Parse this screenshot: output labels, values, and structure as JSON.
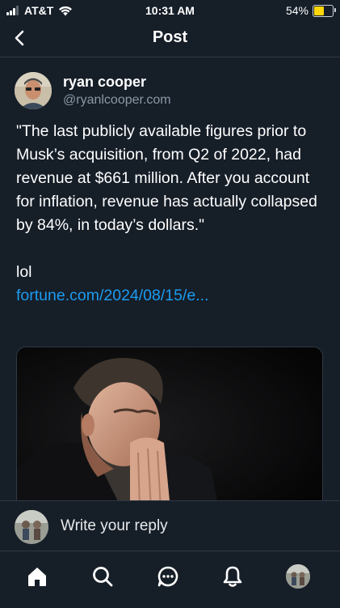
{
  "status_bar": {
    "carrier": "AT&T",
    "time": "10:31 AM",
    "battery_percent": "54%",
    "battery_level": 0.54,
    "battery_color": "#ffd60a",
    "icons": [
      "cellular-signal-icon",
      "wifi-icon",
      "battery-icon"
    ]
  },
  "header": {
    "title": "Post",
    "back_icon": "chevron-left-icon"
  },
  "post": {
    "author": {
      "name": "ryan cooper",
      "handle": "@ryanlcooper.com"
    },
    "text": "\"The last publicly available figures prior to Musk’s acquisition, from Q2 of 2022, had revenue at $661 million. After you account for inflation, revenue has actually collapsed by 84%, in today’s dollars.\"",
    "text_tail": "lol",
    "link": "fortune.com/2024/08/15/e...",
    "link_color": "#1d9bf0"
  },
  "reply": {
    "placeholder": "Write your reply"
  },
  "tab_bar": {
    "tabs": [
      "home-icon",
      "search-icon",
      "chat-icon",
      "bell-icon",
      "profile-avatar"
    ]
  },
  "theme": {
    "background": "#161e28",
    "divider": "#2f3946",
    "secondary_text": "#8b98a5"
  }
}
